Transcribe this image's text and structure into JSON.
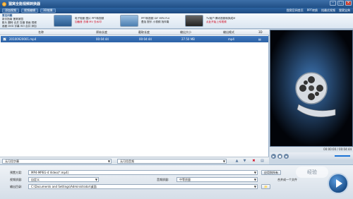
{
  "window": {
    "title": "狸窝全能视频转换器"
  },
  "toolbar": {
    "buttons": [
      "添加视频",
      "视频编辑",
      "3D效果"
    ],
    "links": [
      "狸窝官网首页",
      "PPT转换",
      "找最优视频",
      "狸窝宝典"
    ]
  },
  "banner": {
    "panel1": {
      "head": "常见问题",
      "lines": [
        "新手指南 狸窝家园",
        "影片 翻转 合并 压缩 音画 视频",
        "画面 DVD 字幕 ISO 合并 添加"
      ]
    },
    "panel2": {
      "lines": [
        "电子相册 图片 PPT转视频",
        "加截音 去噪 MV 去水印"
      ]
    },
    "panel3": {
      "lines": [
        "PPT转视频 GIF MP4 FLV",
        "叠加 配乐 小视频 找伴奏"
      ]
    },
    "panel4": {
      "lines": [
        "TV用户·腾讯视频转换成M",
        "点此开始上传视频"
      ]
    }
  },
  "list": {
    "columns": [
      "名称",
      "原始长度",
      "截取长度",
      "输出大小",
      "输出格式",
      "3D"
    ],
    "rows": [
      {
        "checked": "✓",
        "name": "20100920001.mp4",
        "original": "00:04:44",
        "clip": "00:04:44",
        "size": "27.50 MB",
        "format": "mp4"
      }
    ]
  },
  "preview": {
    "time": "00:00:00 / 00:04:44"
  },
  "footer": {
    "subtitle": "无可用字幕",
    "audio": "无可用音频"
  },
  "bottom": {
    "preset_label": "预置方案:",
    "preset_value": "MP4-MPEG-4 Video(*.mp4)",
    "apply_all": "应用到所有",
    "merge": "合并成一个文件",
    "video_quality_label": "视频质量:",
    "video_quality_value": "自定义",
    "audio_quality_label": "音频质量:",
    "audio_quality_value": "中等质量",
    "output_label": "输出目录:",
    "output_value": "C:\\Documents and Settings\\Administrator\\桌面"
  },
  "watermark": "经验",
  "colors": {
    "accent": "#2c62a6",
    "delete": "#d0021b"
  }
}
